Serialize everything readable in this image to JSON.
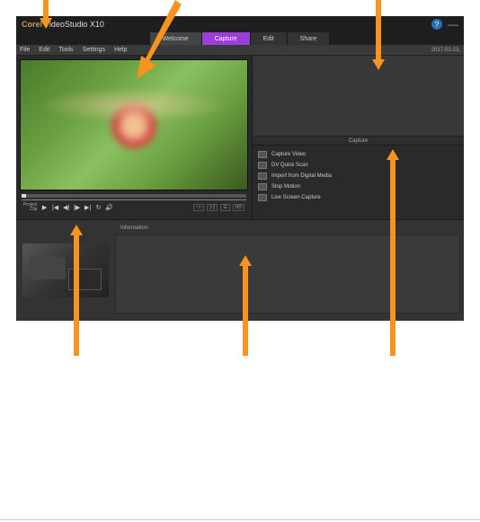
{
  "title": {
    "brand": "Corel",
    "product": "VideoStudio",
    "version": "X10"
  },
  "titlebar": {
    "date": "2017-01-23,"
  },
  "tabs": [
    {
      "label": "Welcome",
      "active": false
    },
    {
      "label": "Capture",
      "active": true
    },
    {
      "label": "Edit",
      "active": false
    },
    {
      "label": "Share",
      "active": false
    }
  ],
  "menu": [
    "File",
    "Edit",
    "Tools",
    "Settings",
    "Help"
  ],
  "playback": {
    "mode_line1": "Project",
    "mode_line2": "Clip",
    "right_buttons": [
      "□□",
      "[□]",
      "☰",
      "HD"
    ]
  },
  "capture_panel": {
    "header": "Capture",
    "items": [
      "Capture Video",
      "DV Quick Scan",
      "Import from Digital Media",
      "Stop Motion",
      "Live Screen Capture"
    ]
  },
  "info_panel": {
    "header": "Information:"
  },
  "arrow_color": "#f7931e"
}
